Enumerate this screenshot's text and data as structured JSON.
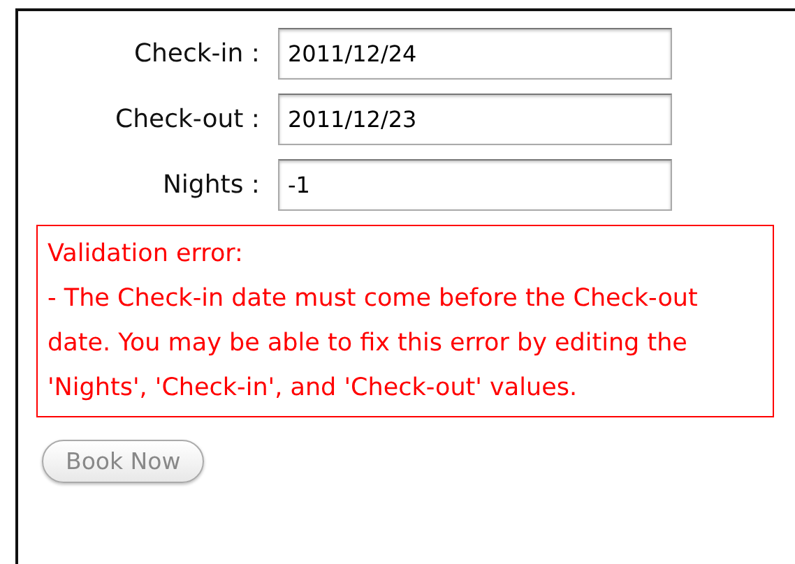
{
  "form": {
    "fields": [
      {
        "label": "Check-in :",
        "value": "2011/12/24"
      },
      {
        "label": "Check-out :",
        "value": "2011/12/23"
      },
      {
        "label": "Nights :",
        "value": "-1"
      }
    ]
  },
  "error": {
    "title": "Validation error:",
    "message": "- The Check-in date must come before the Check-out date. You may be able to fix this error by editing the 'Nights', 'Check-in', and 'Check-out' values."
  },
  "buttons": [
    {
      "label": "Book Now",
      "disabled": true
    }
  ]
}
